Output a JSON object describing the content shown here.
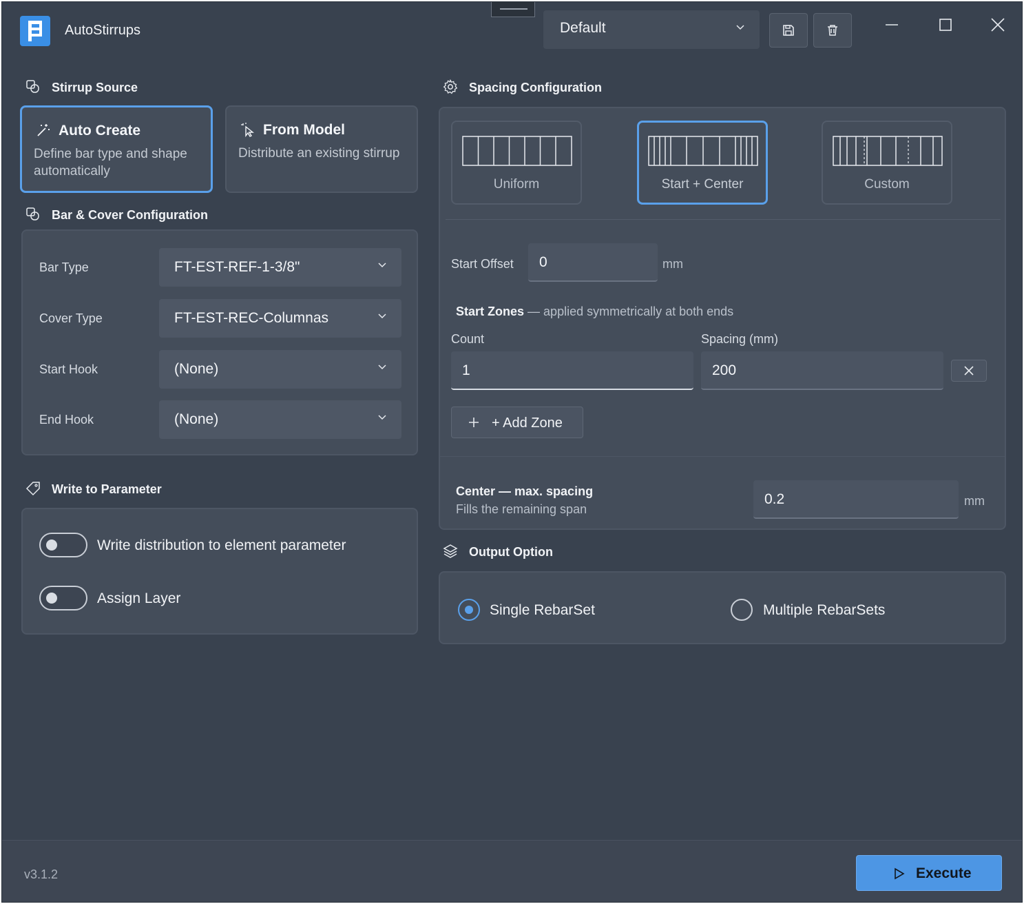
{
  "app": {
    "title": "AutoStirrups",
    "version": "v3.1.2"
  },
  "header": {
    "profile_select": "Default",
    "save_icon": "save-icon",
    "delete_icon": "trash-icon",
    "window_controls": [
      "minimize-icon",
      "maximize-icon",
      "close-icon"
    ]
  },
  "stirrup_source": {
    "title": "Stirrup Source",
    "options": [
      {
        "title": "Auto Create",
        "desc": "Define bar type and shape automatically",
        "selected": true
      },
      {
        "title": "From Model",
        "desc": "Distribute an existing stirrup",
        "selected": false
      }
    ]
  },
  "bar_cover": {
    "title": "Bar & Cover Configuration",
    "fields": [
      {
        "label": "Bar Type",
        "value": "FT-EST-REF-1-3/8\""
      },
      {
        "label": "Cover Type",
        "value": "FT-EST-REC-Columnas"
      },
      {
        "label": "Start Hook",
        "value": "(None)"
      },
      {
        "label": "End Hook",
        "value": "(None)"
      }
    ]
  },
  "write_param": {
    "title": "Write to Parameter",
    "toggles": [
      {
        "label": "Write distribution to element parameter",
        "on": false
      },
      {
        "label": "Assign Layer",
        "on": false
      }
    ]
  },
  "spacing": {
    "title": "Spacing Configuration",
    "modes": [
      {
        "label": "Uniform",
        "selected": false
      },
      {
        "label": "Start + Center",
        "selected": true
      },
      {
        "label": "Custom",
        "selected": false
      }
    ],
    "start_offset_label": "Start Offset",
    "start_offset_value": "0",
    "unit": "mm",
    "zones_title": "Start Zones",
    "zones_note": "— applied symmetrically at both ends",
    "count_label": "Count",
    "spacing_label": "Spacing (mm)",
    "zone_count": "1",
    "zone_spacing": "200",
    "add_zone": "+ Add Zone",
    "center_title": "Center — max. spacing",
    "center_desc": "Fills the remaining span",
    "center_value": "0.2",
    "center_unit": "mm"
  },
  "output": {
    "title": "Output Option",
    "options": [
      {
        "label": "Single RebarSet",
        "selected": true
      },
      {
        "label": "Multiple RebarSets",
        "selected": false
      }
    ]
  },
  "footer": {
    "execute": "Execute"
  },
  "colors": {
    "accent": "#5aa0ea",
    "background": "#39424f",
    "panel": "#444d5a"
  }
}
